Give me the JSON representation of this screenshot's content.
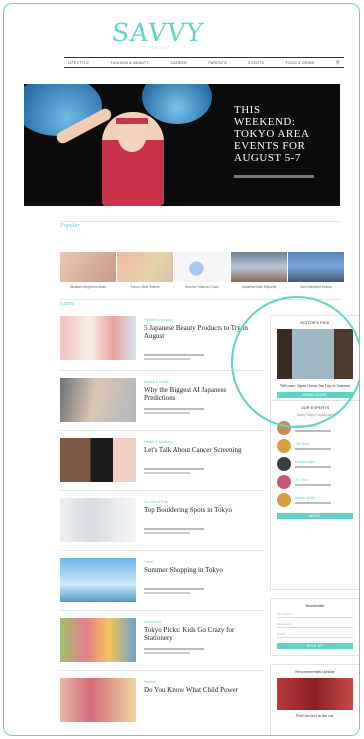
{
  "brand": {
    "logo": "SAVVY",
    "tagline": "TOKYO"
  },
  "nav": {
    "items": [
      "LIFESTYLE",
      "FASHION & BEAUTY",
      "CAREER",
      "PARENTS",
      "EVENTS",
      "FOOD & DRINK"
    ],
    "search_icon": "search-icon"
  },
  "hero": {
    "title": "THIS WEEKEND: TOKYO AREA EVENTS FOR AUGUST 5-7"
  },
  "sections": {
    "popular": "Popular",
    "latest": "Latest"
  },
  "popular": [
    {
      "caption": "Mistakes Beginners Make"
    },
    {
      "caption": "Tokyo's Best Sweets"
    },
    {
      "caption": "Summer Makeup Guide"
    },
    {
      "caption": "Japanese Bath Etiquette"
    },
    {
      "caption": "Best Weekend Events"
    }
  ],
  "articles": [
    {
      "category": "Fashion & Beauty",
      "title": "5 Japanese Beauty Products to Try in August"
    },
    {
      "category": "Beauty & Health",
      "title": "Why the Biggest AI Japanese Predictions"
    },
    {
      "category": "Health & Wellness",
      "title": "Let's Talk About Cancer Screening"
    },
    {
      "category": "Do, See & Play",
      "title": "Top Bouldering Spots in Tokyo"
    },
    {
      "category": "Travel",
      "title": "Summer Shopping in Tokyo"
    },
    {
      "category": "Sponsored",
      "title": "Tokyo Picks: Kids Go Crazy for Stationery"
    },
    {
      "category": "Parents",
      "title": "Do You Know What Child Power"
    }
  ],
  "sidebar": {
    "feature_heading": "EDITOR'S PICK",
    "feature_caption": "Welcome: Japan Onsen Inn Trip in Summer",
    "feature_button": "READ MORE",
    "experts_heading": "OUR EXPERTS",
    "experts_sub": "Savvy Tokyo Contributors",
    "experts": [
      {
        "name": "Sophia Wood"
      },
      {
        "name": "Tim Ward"
      },
      {
        "name": "Kanako Sato"
      },
      {
        "name": "Jin Oka"
      },
      {
        "name": "Naomi Smith"
      }
    ],
    "experts_button": "MORE",
    "newsletter_heading": "Newsletter",
    "newsletter_fields": [
      "First Name",
      "Last Name",
      "Email"
    ],
    "newsletter_button": "SIGN UP",
    "recommend_heading": "Recommended Article",
    "recommend_caption": "Find the best in the city"
  }
}
